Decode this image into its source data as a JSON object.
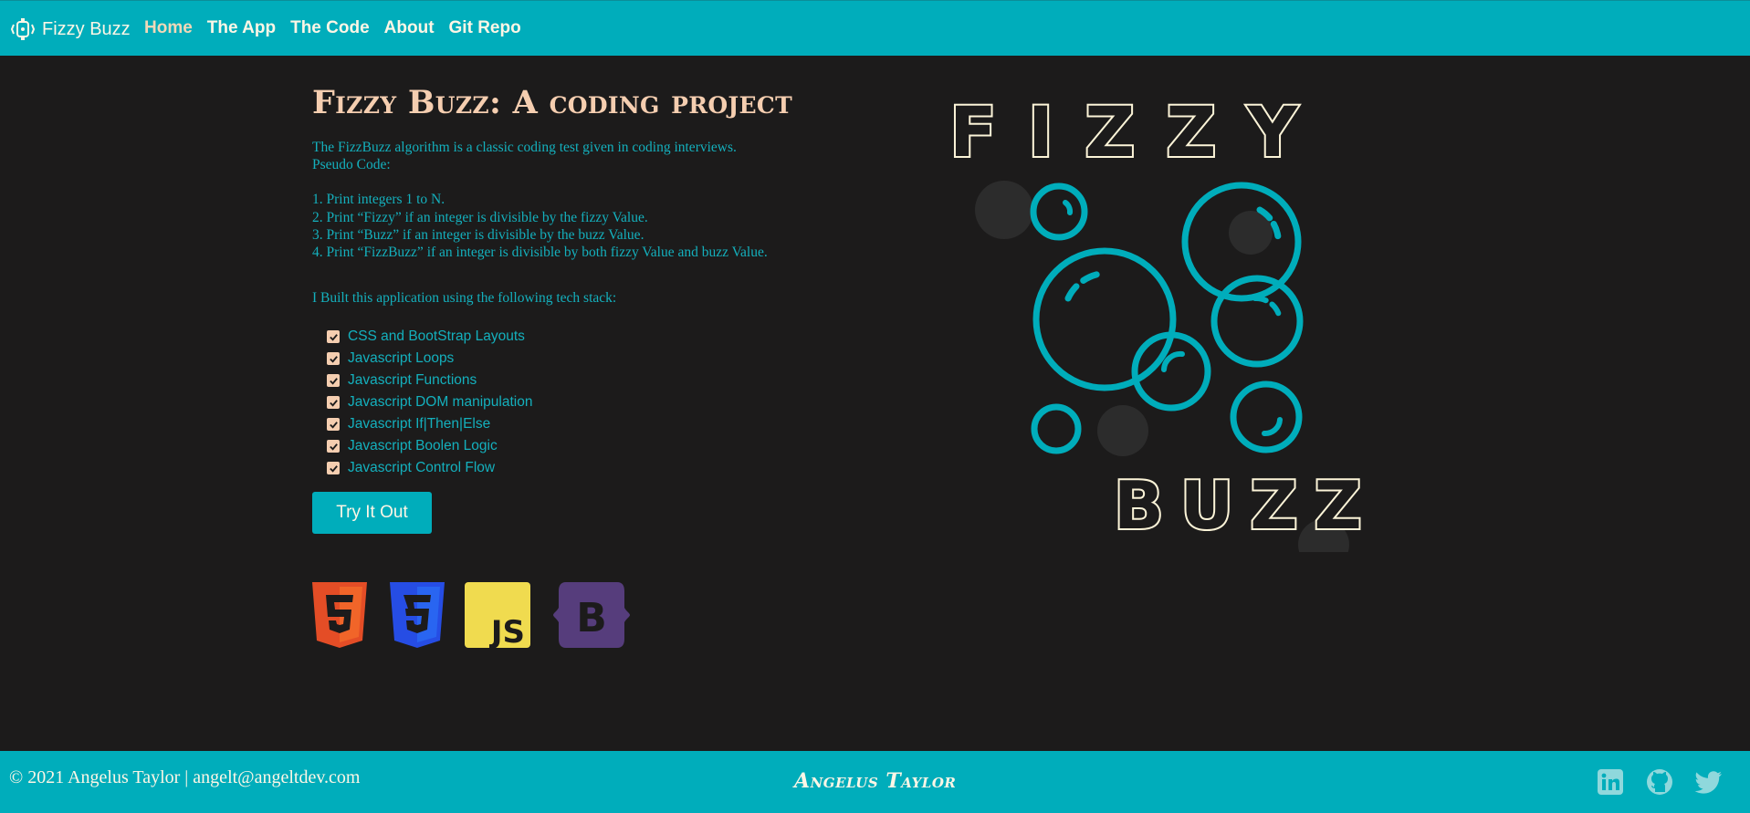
{
  "navbar": {
    "brand": "Fizzy Buzz",
    "links": [
      "Home",
      "The App",
      "The Code",
      "About",
      "Git Repo"
    ]
  },
  "main": {
    "title": "Fizzy Buzz: A coding project",
    "intro": "The FizzBuzz algorithm is a classic coding test given in coding interviews.",
    "pseudo_label": "Pseudo Code:",
    "steps": [
      "1. Print integers 1 to N.",
      "2. Print “Fizzy” if an integer is divisible by the fizzy Value.",
      "3. Print “Buzz” if an integer is divisible by the buzz Value.",
      "4. Print “FizzBuzz” if an integer is divisible by both fizzy Value and buzz Value."
    ],
    "stack_intro": "I Built this application using the following tech stack:",
    "stack": [
      "CSS and BootStrap Layouts",
      "Javascript Loops",
      "Javascript Functions",
      "Javascript DOM manipulation",
      "Javascript If|Then|Else",
      "Javascript Boolen Logic",
      "Javascript Control Flow"
    ],
    "cta": "Try It Out",
    "tech_icons": [
      "html5-icon",
      "css3-icon",
      "javascript-icon",
      "bootstrap-icon"
    ]
  },
  "logo": {
    "word_top": "FIZZY",
    "word_bottom": "BUZZ"
  },
  "footer": {
    "copyright": "© 2021 Angelus Taylor | angelt@angeltdev.com",
    "signature": "Angelus Taylor",
    "social": [
      "linkedin-icon",
      "github-icon",
      "twitter-icon"
    ]
  },
  "colors": {
    "teal": "#00adbb",
    "background": "#1c1b1b",
    "peach": "#f5ceb0",
    "cream": "#fdf6e6",
    "text_teal": "#14b0bd"
  }
}
